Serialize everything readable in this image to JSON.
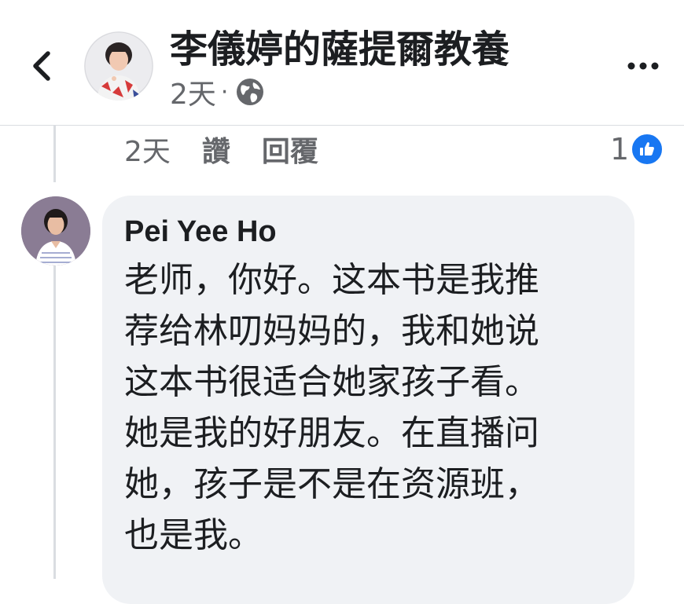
{
  "header": {
    "title": "李儀婷的薩提爾教養",
    "time": "2天",
    "separator": "·",
    "back_icon": "chevron-left-icon",
    "privacy_icon": "globe-icon",
    "more_icon": "more-dots-icon"
  },
  "previous_comment": {
    "time": "2天",
    "like_label": "讚",
    "reply_label": "回覆",
    "reaction_count": "1",
    "reaction_icon": "like-thumb-icon"
  },
  "comment": {
    "author": "Pei Yee Ho",
    "lines": [
      "老师，你好。这本书是我推",
      "荐给林叨妈妈的，我和她说",
      "这本书很适合她家孩子看。",
      "她是我的好朋友。在直播问",
      "她，孩子是不是在资源班，",
      "也是我。"
    ]
  },
  "colors": {
    "accent": "#1877f2",
    "secondary_text": "#65676b",
    "bubble": "#f0f2f5",
    "primary_text": "#1c1e21"
  }
}
